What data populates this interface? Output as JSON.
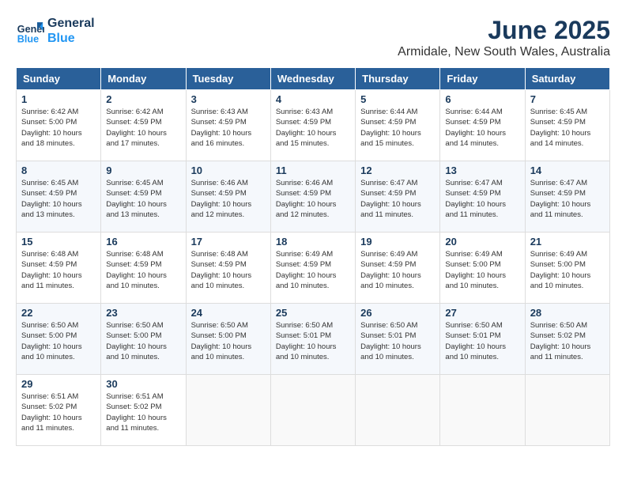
{
  "header": {
    "logo_line1": "General",
    "logo_line2": "Blue",
    "month_year": "June 2025",
    "location": "Armidale, New South Wales, Australia"
  },
  "days_of_week": [
    "Sunday",
    "Monday",
    "Tuesday",
    "Wednesday",
    "Thursday",
    "Friday",
    "Saturday"
  ],
  "weeks": [
    [
      {
        "day": "1",
        "sunrise": "6:42 AM",
        "sunset": "5:00 PM",
        "daylight": "10 hours and 18 minutes."
      },
      {
        "day": "2",
        "sunrise": "6:42 AM",
        "sunset": "4:59 PM",
        "daylight": "10 hours and 17 minutes."
      },
      {
        "day": "3",
        "sunrise": "6:43 AM",
        "sunset": "4:59 PM",
        "daylight": "10 hours and 16 minutes."
      },
      {
        "day": "4",
        "sunrise": "6:43 AM",
        "sunset": "4:59 PM",
        "daylight": "10 hours and 15 minutes."
      },
      {
        "day": "5",
        "sunrise": "6:44 AM",
        "sunset": "4:59 PM",
        "daylight": "10 hours and 15 minutes."
      },
      {
        "day": "6",
        "sunrise": "6:44 AM",
        "sunset": "4:59 PM",
        "daylight": "10 hours and 14 minutes."
      },
      {
        "day": "7",
        "sunrise": "6:45 AM",
        "sunset": "4:59 PM",
        "daylight": "10 hours and 14 minutes."
      }
    ],
    [
      {
        "day": "8",
        "sunrise": "6:45 AM",
        "sunset": "4:59 PM",
        "daylight": "10 hours and 13 minutes."
      },
      {
        "day": "9",
        "sunrise": "6:45 AM",
        "sunset": "4:59 PM",
        "daylight": "10 hours and 13 minutes."
      },
      {
        "day": "10",
        "sunrise": "6:46 AM",
        "sunset": "4:59 PM",
        "daylight": "10 hours and 12 minutes."
      },
      {
        "day": "11",
        "sunrise": "6:46 AM",
        "sunset": "4:59 PM",
        "daylight": "10 hours and 12 minutes."
      },
      {
        "day": "12",
        "sunrise": "6:47 AM",
        "sunset": "4:59 PM",
        "daylight": "10 hours and 11 minutes."
      },
      {
        "day": "13",
        "sunrise": "6:47 AM",
        "sunset": "4:59 PM",
        "daylight": "10 hours and 11 minutes."
      },
      {
        "day": "14",
        "sunrise": "6:47 AM",
        "sunset": "4:59 PM",
        "daylight": "10 hours and 11 minutes."
      }
    ],
    [
      {
        "day": "15",
        "sunrise": "6:48 AM",
        "sunset": "4:59 PM",
        "daylight": "10 hours and 11 minutes."
      },
      {
        "day": "16",
        "sunrise": "6:48 AM",
        "sunset": "4:59 PM",
        "daylight": "10 hours and 10 minutes."
      },
      {
        "day": "17",
        "sunrise": "6:48 AM",
        "sunset": "4:59 PM",
        "daylight": "10 hours and 10 minutes."
      },
      {
        "day": "18",
        "sunrise": "6:49 AM",
        "sunset": "4:59 PM",
        "daylight": "10 hours and 10 minutes."
      },
      {
        "day": "19",
        "sunrise": "6:49 AM",
        "sunset": "4:59 PM",
        "daylight": "10 hours and 10 minutes."
      },
      {
        "day": "20",
        "sunrise": "6:49 AM",
        "sunset": "5:00 PM",
        "daylight": "10 hours and 10 minutes."
      },
      {
        "day": "21",
        "sunrise": "6:49 AM",
        "sunset": "5:00 PM",
        "daylight": "10 hours and 10 minutes."
      }
    ],
    [
      {
        "day": "22",
        "sunrise": "6:50 AM",
        "sunset": "5:00 PM",
        "daylight": "10 hours and 10 minutes."
      },
      {
        "day": "23",
        "sunrise": "6:50 AM",
        "sunset": "5:00 PM",
        "daylight": "10 hours and 10 minutes."
      },
      {
        "day": "24",
        "sunrise": "6:50 AM",
        "sunset": "5:00 PM",
        "daylight": "10 hours and 10 minutes."
      },
      {
        "day": "25",
        "sunrise": "6:50 AM",
        "sunset": "5:01 PM",
        "daylight": "10 hours and 10 minutes."
      },
      {
        "day": "26",
        "sunrise": "6:50 AM",
        "sunset": "5:01 PM",
        "daylight": "10 hours and 10 minutes."
      },
      {
        "day": "27",
        "sunrise": "6:50 AM",
        "sunset": "5:01 PM",
        "daylight": "10 hours and 10 minutes."
      },
      {
        "day": "28",
        "sunrise": "6:50 AM",
        "sunset": "5:02 PM",
        "daylight": "10 hours and 11 minutes."
      }
    ],
    [
      {
        "day": "29",
        "sunrise": "6:51 AM",
        "sunset": "5:02 PM",
        "daylight": "10 hours and 11 minutes."
      },
      {
        "day": "30",
        "sunrise": "6:51 AM",
        "sunset": "5:02 PM",
        "daylight": "10 hours and 11 minutes."
      },
      null,
      null,
      null,
      null,
      null
    ]
  ]
}
